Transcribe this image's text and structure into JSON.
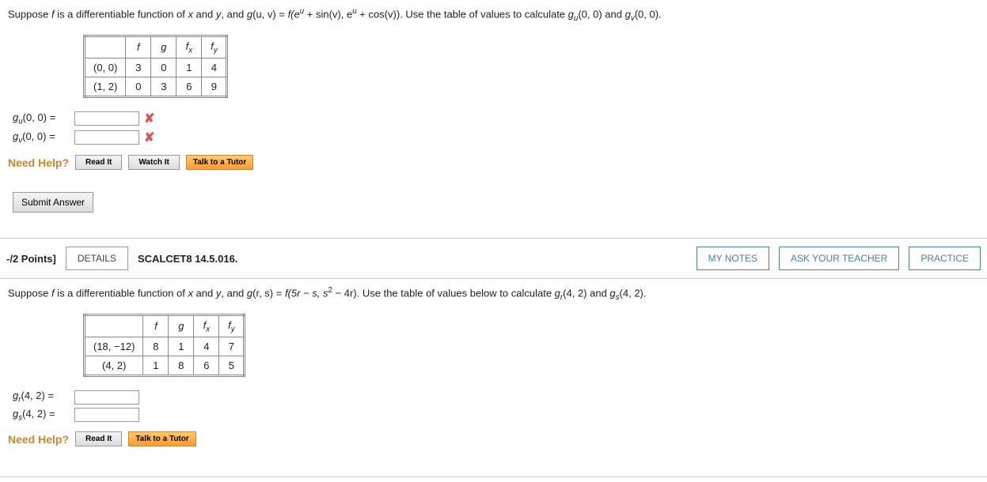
{
  "q1": {
    "prompt_pre": "Suppose ",
    "prompt_f": "f",
    "prompt_mid1": " is a differentiable function of ",
    "prompt_x": "x",
    "prompt_and1": " and ",
    "prompt_y": "y",
    "prompt_mid2": ", and ",
    "prompt_g": "g",
    "prompt_uv": "(u, v) = ",
    "prompt_feq": "f(e",
    "prompt_exp_u1": "u",
    "prompt_plus_sinv": " + sin(v), e",
    "prompt_exp_u2": "u",
    "prompt_plus_cosv": " + cos(v)).  Use the table of values to calculate ",
    "prompt_gu": "g",
    "prompt_sub_u": "u",
    "prompt_00a": "(0, 0)  and ",
    "prompt_gv": "g",
    "prompt_sub_v": "v",
    "prompt_00b": "(0, 0).",
    "table": {
      "headers": [
        "",
        "f",
        "g",
        "f_x",
        "f_y"
      ],
      "rows": [
        {
          "label": "(0, 0)",
          "cells": [
            "3",
            "0",
            "1",
            "4"
          ]
        },
        {
          "label": "(1, 2)",
          "cells": [
            "0",
            "3",
            "6",
            "9"
          ]
        }
      ]
    },
    "ans1_label_g": "g",
    "ans1_label_sub": "u",
    "ans1_label_tail": "(0, 0)  = ",
    "ans2_label_g": "g",
    "ans2_label_sub": "v",
    "ans2_label_tail": "(0, 0)  = "
  },
  "help": {
    "label": "Need Help?",
    "read": "Read It",
    "watch": "Watch It",
    "tutor": "Talk to a Tutor"
  },
  "submit": "Submit Answer",
  "bar": {
    "points": "-/2 Points]",
    "details": "DETAILS",
    "ref": "SCALCET8 14.5.016.",
    "notes": "MY NOTES",
    "ask": "ASK YOUR TEACHER",
    "practice": "PRACTICE"
  },
  "q2": {
    "prompt_pre": "Suppose ",
    "prompt_f": "f",
    "prompt_mid1": " is a differentiable function of ",
    "prompt_x": "x",
    "prompt_and1": " and ",
    "prompt_y": "y",
    "prompt_mid2": ", and ",
    "prompt_g": "g",
    "prompt_rs": "(r, s) = ",
    "prompt_feq": "f(5r − s, s",
    "prompt_exp_2": "2",
    "prompt_minus4r": " − 4r).  Use the table of values below to calculate ",
    "prompt_gr": "g",
    "prompt_sub_r": "r",
    "prompt_42a": "(4, 2)  and ",
    "prompt_gs": "g",
    "prompt_sub_s": "s",
    "prompt_42b": "(4, 2).",
    "table": {
      "headers": [
        "",
        "f",
        "g",
        "f_x",
        "f_y"
      ],
      "rows": [
        {
          "label": "(18, −12)",
          "cells": [
            "8",
            "1",
            "4",
            "7"
          ]
        },
        {
          "label": "(4, 2)",
          "cells": [
            "1",
            "8",
            "6",
            "5"
          ]
        }
      ]
    },
    "ans1_label_g": "g",
    "ans1_label_sub": "r",
    "ans1_label_tail": "(4, 2)  = ",
    "ans2_label_g": "g",
    "ans2_label_sub": "s",
    "ans2_label_tail": "(4, 2)  = "
  }
}
